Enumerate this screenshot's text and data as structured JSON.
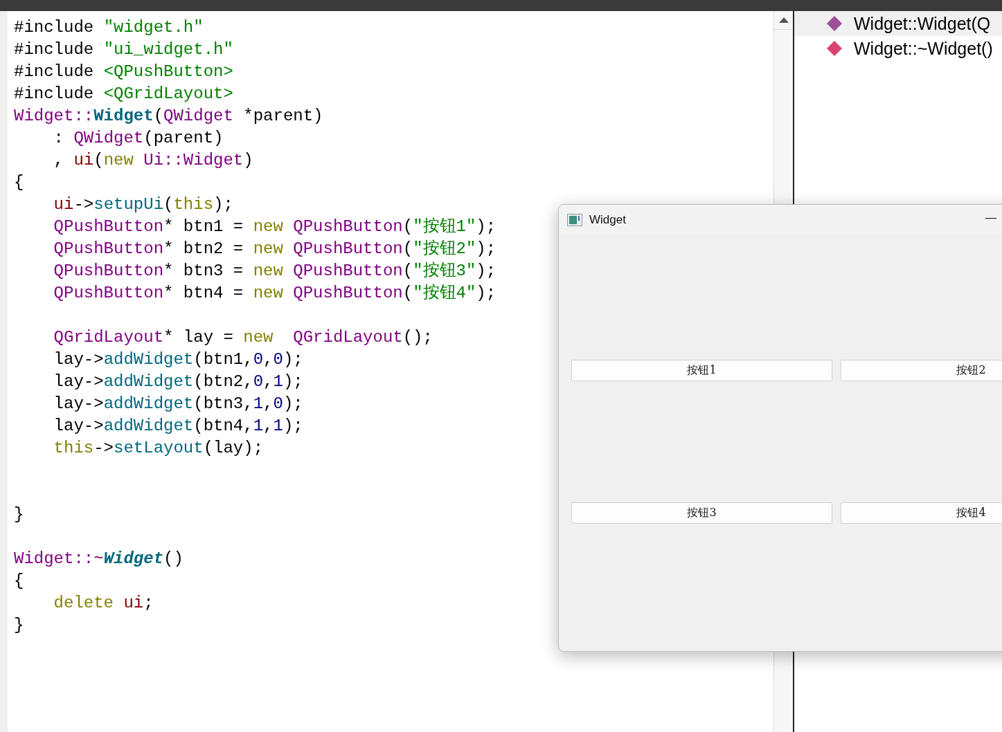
{
  "code_lines": [
    {
      "kind": "code",
      "tokens": [
        {
          "kind": "plain",
          "text": "#include "
        },
        {
          "kind": "string",
          "text": "\"widget.h\""
        }
      ]
    },
    {
      "kind": "code",
      "tokens": [
        {
          "kind": "plain",
          "text": "#include "
        },
        {
          "kind": "string",
          "text": "\"ui_widget.h\""
        }
      ]
    },
    {
      "kind": "code",
      "tokens": [
        {
          "kind": "plain",
          "text": "#include "
        },
        {
          "kind": "string",
          "text": "<QPushButton>"
        }
      ]
    },
    {
      "kind": "code",
      "tokens": [
        {
          "kind": "plain",
          "text": "#include "
        },
        {
          "kind": "string",
          "text": "<QGridLayout>"
        }
      ]
    },
    {
      "kind": "code",
      "tokens": [
        {
          "kind": "type",
          "text": "Widget::"
        },
        {
          "kind": "decl",
          "text": "Widget"
        },
        {
          "kind": "plain",
          "text": "("
        },
        {
          "kind": "type",
          "text": "QWidget"
        },
        {
          "kind": "plain",
          "text": " *parent)"
        }
      ]
    },
    {
      "kind": "code",
      "tokens": [
        {
          "kind": "plain",
          "text": "    : "
        },
        {
          "kind": "type",
          "text": "QWidget"
        },
        {
          "kind": "plain",
          "text": "(parent)"
        }
      ]
    },
    {
      "kind": "code",
      "tokens": [
        {
          "kind": "plain",
          "text": "    , "
        },
        {
          "kind": "member",
          "text": "ui"
        },
        {
          "kind": "plain",
          "text": "("
        },
        {
          "kind": "keyword",
          "text": "new "
        },
        {
          "kind": "type",
          "text": "Ui::Widget"
        },
        {
          "kind": "plain",
          "text": ")"
        }
      ]
    },
    {
      "kind": "code",
      "tokens": [
        {
          "kind": "plain",
          "text": "{"
        }
      ]
    },
    {
      "kind": "code",
      "tokens": [
        {
          "kind": "member",
          "text": "    ui"
        },
        {
          "kind": "plain",
          "text": "->"
        },
        {
          "kind": "func",
          "text": "setupUi"
        },
        {
          "kind": "plain",
          "text": "("
        },
        {
          "kind": "keyword",
          "text": "this"
        },
        {
          "kind": "plain",
          "text": ");"
        }
      ]
    },
    {
      "kind": "code",
      "tokens": [
        {
          "kind": "type",
          "text": "    QPushButton"
        },
        {
          "kind": "plain",
          "text": "* btn1 = "
        },
        {
          "kind": "keyword",
          "text": "new "
        },
        {
          "kind": "type",
          "text": "QPushButton"
        },
        {
          "kind": "plain",
          "text": "("
        },
        {
          "kind": "string",
          "text": "\"按钮1\""
        },
        {
          "kind": "plain",
          "text": ");"
        }
      ]
    },
    {
      "kind": "code",
      "tokens": [
        {
          "kind": "type",
          "text": "    QPushButton"
        },
        {
          "kind": "plain",
          "text": "* btn2 = "
        },
        {
          "kind": "keyword",
          "text": "new "
        },
        {
          "kind": "type",
          "text": "QPushButton"
        },
        {
          "kind": "plain",
          "text": "("
        },
        {
          "kind": "string",
          "text": "\"按钮2\""
        },
        {
          "kind": "plain",
          "text": ");"
        }
      ]
    },
    {
      "kind": "code",
      "tokens": [
        {
          "kind": "type",
          "text": "    QPushButton"
        },
        {
          "kind": "plain",
          "text": "* btn3 = "
        },
        {
          "kind": "keyword",
          "text": "new "
        },
        {
          "kind": "type",
          "text": "QPushButton"
        },
        {
          "kind": "plain",
          "text": "("
        },
        {
          "kind": "string",
          "text": "\"按钮3\""
        },
        {
          "kind": "plain",
          "text": ");"
        }
      ]
    },
    {
      "kind": "code",
      "tokens": [
        {
          "kind": "type",
          "text": "    QPushButton"
        },
        {
          "kind": "plain",
          "text": "* btn4 = "
        },
        {
          "kind": "keyword",
          "text": "new "
        },
        {
          "kind": "type",
          "text": "QPushButton"
        },
        {
          "kind": "plain",
          "text": "("
        },
        {
          "kind": "string",
          "text": "\"按钮4\""
        },
        {
          "kind": "plain",
          "text": ");"
        }
      ]
    },
    {
      "kind": "blank"
    },
    {
      "kind": "code",
      "tokens": [
        {
          "kind": "type",
          "text": "    QGridLayout"
        },
        {
          "kind": "plain",
          "text": "* lay = "
        },
        {
          "kind": "keyword",
          "text": "new  "
        },
        {
          "kind": "type",
          "text": "QGridLayout"
        },
        {
          "kind": "plain",
          "text": "();"
        }
      ]
    },
    {
      "kind": "code",
      "tokens": [
        {
          "kind": "plain",
          "text": "    lay->"
        },
        {
          "kind": "func",
          "text": "addWidget"
        },
        {
          "kind": "plain",
          "text": "(btn1,"
        },
        {
          "kind": "number",
          "text": "0"
        },
        {
          "kind": "plain",
          "text": ","
        },
        {
          "kind": "number",
          "text": "0"
        },
        {
          "kind": "plain",
          "text": ");"
        }
      ]
    },
    {
      "kind": "code",
      "tokens": [
        {
          "kind": "plain",
          "text": "    lay->"
        },
        {
          "kind": "func",
          "text": "addWidget"
        },
        {
          "kind": "plain",
          "text": "(btn2,"
        },
        {
          "kind": "number",
          "text": "0"
        },
        {
          "kind": "plain",
          "text": ","
        },
        {
          "kind": "number",
          "text": "1"
        },
        {
          "kind": "plain",
          "text": ");"
        }
      ]
    },
    {
      "kind": "code",
      "tokens": [
        {
          "kind": "plain",
          "text": "    lay->"
        },
        {
          "kind": "func",
          "text": "addWidget"
        },
        {
          "kind": "plain",
          "text": "(btn3,"
        },
        {
          "kind": "number",
          "text": "1"
        },
        {
          "kind": "plain",
          "text": ","
        },
        {
          "kind": "number",
          "text": "0"
        },
        {
          "kind": "plain",
          "text": ");"
        }
      ]
    },
    {
      "kind": "code",
      "tokens": [
        {
          "kind": "plain",
          "text": "    lay->"
        },
        {
          "kind": "func",
          "text": "addWidget"
        },
        {
          "kind": "plain",
          "text": "(btn4,"
        },
        {
          "kind": "number",
          "text": "1"
        },
        {
          "kind": "plain",
          "text": ","
        },
        {
          "kind": "number",
          "text": "1"
        },
        {
          "kind": "plain",
          "text": ");"
        }
      ]
    },
    {
      "kind": "code",
      "tokens": [
        {
          "kind": "keyword",
          "text": "    this"
        },
        {
          "kind": "plain",
          "text": "->"
        },
        {
          "kind": "func",
          "text": "setLayout"
        },
        {
          "kind": "plain",
          "text": "(lay);"
        }
      ]
    },
    {
      "kind": "blank"
    },
    {
      "kind": "blank"
    },
    {
      "kind": "code",
      "tokens": [
        {
          "kind": "plain",
          "text": "}"
        }
      ]
    },
    {
      "kind": "blank"
    },
    {
      "kind": "code",
      "tokens": [
        {
          "kind": "type",
          "text": "Widget::~"
        },
        {
          "kind": "decl-italic",
          "text": "Widget"
        },
        {
          "kind": "plain",
          "text": "()"
        }
      ]
    },
    {
      "kind": "code",
      "tokens": [
        {
          "kind": "plain",
          "text": "{"
        }
      ]
    },
    {
      "kind": "code",
      "tokens": [
        {
          "kind": "keyword",
          "text": "    delete "
        },
        {
          "kind": "member",
          "text": "ui"
        },
        {
          "kind": "plain",
          "text": ";"
        }
      ]
    },
    {
      "kind": "code",
      "tokens": [
        {
          "kind": "plain",
          "text": "}"
        }
      ]
    }
  ],
  "outline": {
    "items": [
      {
        "label": "Widget::Widget(Q",
        "color": "#9b4f96",
        "selected": true
      },
      {
        "label": "Widget::~Widget()",
        "color": "#d9436f",
        "selected": false
      }
    ]
  },
  "preview_window": {
    "title": "Widget",
    "minimize": "—",
    "buttons": [
      {
        "label": "按钮1"
      },
      {
        "label": "按钮2"
      },
      {
        "label": "按钮3"
      },
      {
        "label": "按钮4"
      }
    ]
  }
}
